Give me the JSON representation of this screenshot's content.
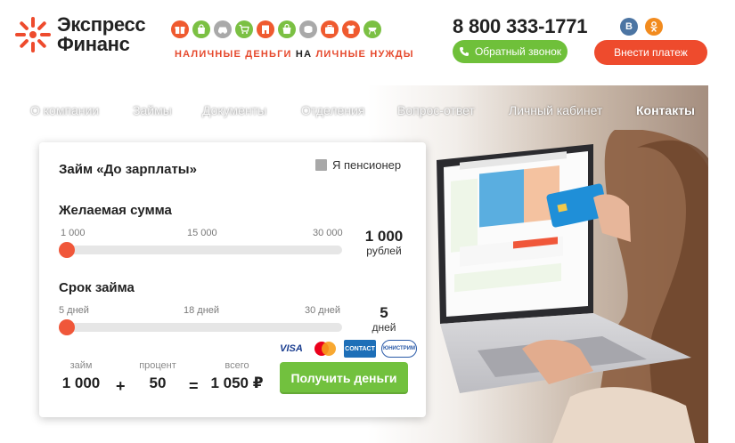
{
  "header": {
    "logo_line1": "Экспресс",
    "logo_line2": "Финанс",
    "tagline_left": "НАЛИЧНЫЕ ДЕНЬГИ",
    "tagline_mid": "НА",
    "tagline_right": "ЛИЧНЫЕ НУЖДЫ",
    "phone": "8 800 333-1771",
    "callback_label": "Обратный звонок",
    "pay_label": "Внести платеж",
    "social": {
      "vk": "В",
      "ok": "ok"
    },
    "categories": [
      {
        "icon": "gift-icon",
        "color": "#ef5a2f"
      },
      {
        "icon": "bag-icon",
        "color": "#7bc043"
      },
      {
        "icon": "car-icon",
        "color": "#a9a9a9"
      },
      {
        "icon": "cart-icon",
        "color": "#7bc043"
      },
      {
        "icon": "building-icon",
        "color": "#ef5a2f"
      },
      {
        "icon": "shopping-bag-icon",
        "color": "#7bc043"
      },
      {
        "icon": "coins-icon",
        "color": "#a9a9a9"
      },
      {
        "icon": "suitcase-icon",
        "color": "#ef5a2f"
      },
      {
        "icon": "shirt-icon",
        "color": "#ef5a2f"
      },
      {
        "icon": "grill-icon",
        "color": "#7bc043"
      }
    ],
    "colors": {
      "brand_orange": "#ee4b2d",
      "brand_green": "#6fc03a"
    }
  },
  "nav": {
    "items": [
      "О компании",
      "Займы",
      "Документы",
      "Отделения",
      "Вопрос-ответ",
      "Личный кабинет",
      "Контакты"
    ],
    "active": "Контакты"
  },
  "calculator": {
    "title": "Займ «До зарплаты»",
    "pensioner_label": "Я пенсионер",
    "amount": {
      "title": "Желаемая сумма",
      "ticks": [
        "1 000",
        "15 000",
        "30 000"
      ],
      "value": "1 000",
      "unit": "рублей",
      "slider_fraction": 0
    },
    "term": {
      "title": "Срок займа",
      "ticks": [
        "5 дней",
        "18 дней",
        "30 дней"
      ],
      "value": "5",
      "unit": "дней",
      "slider_fraction": 0
    },
    "payment_systems": [
      "VISA",
      "MasterCard",
      "CONTACT",
      "ЮНИСТРИМ"
    ],
    "summary": {
      "loan_label": "займ",
      "loan_value": "1 000",
      "percent_label": "процент",
      "percent_value": "50",
      "total_label": "всего",
      "total_value": "1 050 ₽",
      "plus": "+",
      "equals": "="
    },
    "submit_label": "Получить деньги"
  }
}
